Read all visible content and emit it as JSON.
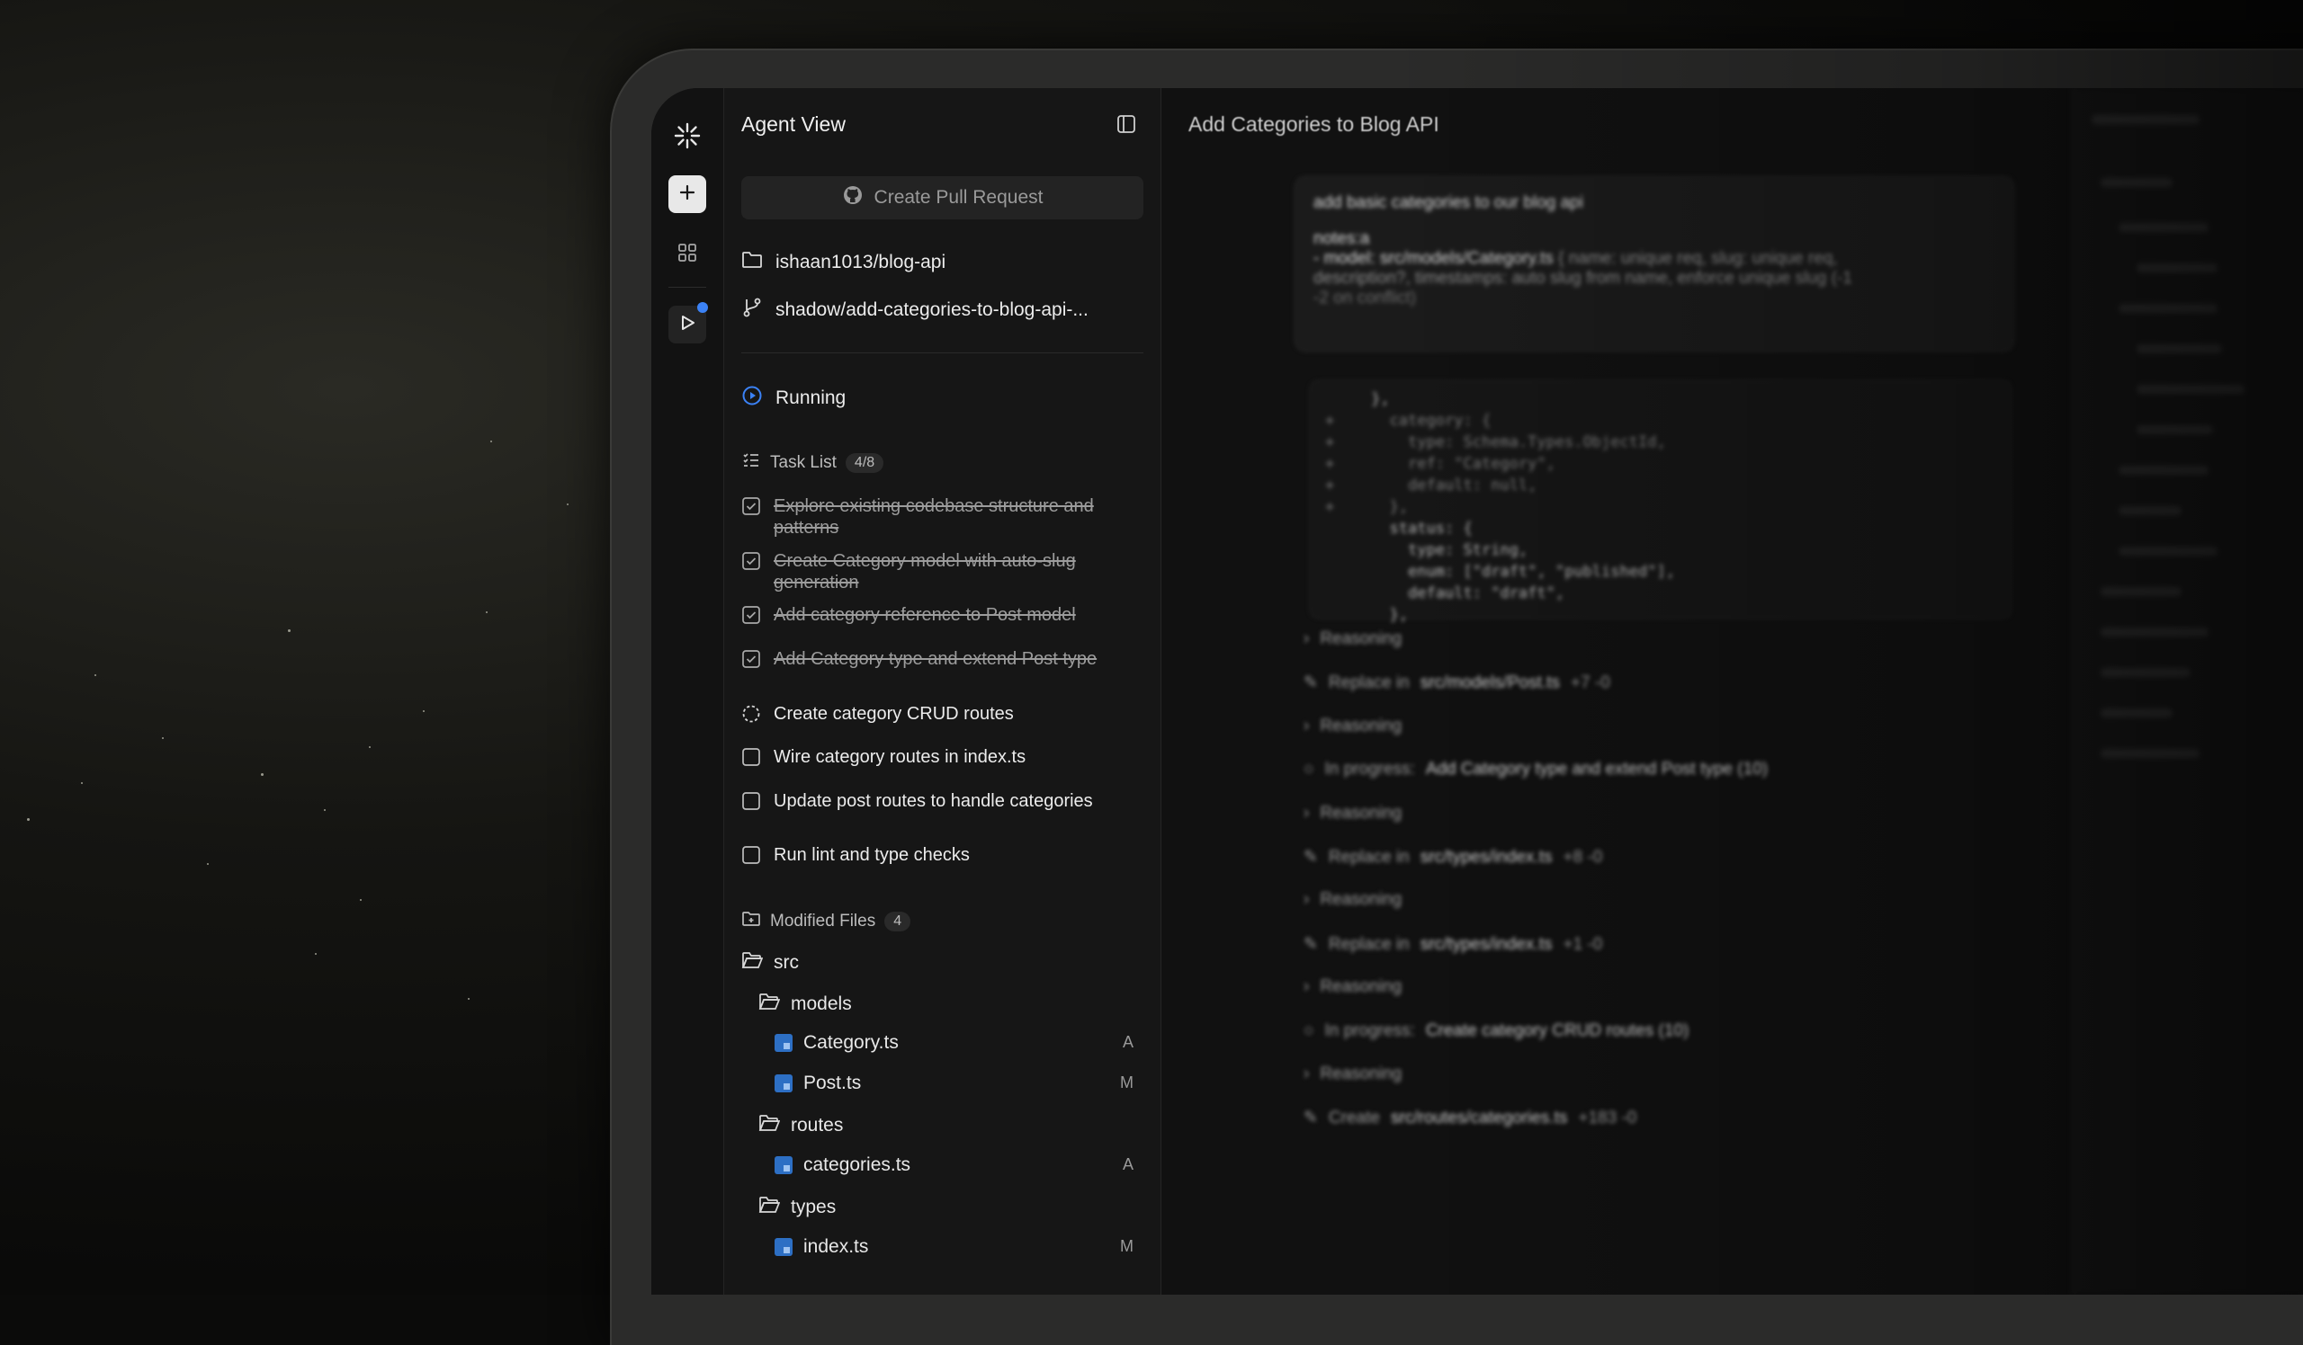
{
  "sidebar": {
    "title": "Agent View",
    "create_pr_label": "Create Pull Request",
    "repo": "ishaan1013/blog-api",
    "branch": "shadow/add-categories-to-blog-api-...",
    "status": "Running",
    "task_list": {
      "label": "Task List",
      "count": "4/8",
      "items": [
        {
          "label": "Explore existing codebase structure and patterns",
          "state": "done"
        },
        {
          "label": "Create Category model with auto-slug generation",
          "state": "done"
        },
        {
          "label": "Add category reference to Post model",
          "state": "done"
        },
        {
          "label": "Add Category type and extend Post type",
          "state": "done"
        },
        {
          "label": "Create category CRUD routes",
          "state": "in_progress"
        },
        {
          "label": "Wire category routes in index.ts",
          "state": "todo"
        },
        {
          "label": "Update post routes to handle categories",
          "state": "todo"
        },
        {
          "label": "Run lint and type checks",
          "state": "todo"
        }
      ]
    },
    "modified_files": {
      "label": "Modified Files",
      "count": "4",
      "tree": {
        "src": "src",
        "models": "models",
        "category_file": "Category.ts",
        "category_badge": "A",
        "post_file": "Post.ts",
        "post_badge": "M",
        "routes": "routes",
        "categories_file": "categories.ts",
        "categories_badge": "A",
        "types": "types",
        "index_file": "index.ts",
        "index_badge": "M"
      }
    }
  },
  "main": {
    "title": "Add Categories to Blog API",
    "user_message": {
      "line1": "add basic categories to our blog api",
      "line2": "notes:a",
      "line3_prefix": "- model: src/models/Category.ts",
      "line3_rest": "{ name: unique req, slug: unique req,",
      "line4": "description?, timestamps: auto slug from name, enforce unique slug (-1",
      "line5": "-2 on conflict)"
    },
    "code_lines": [
      "     },",
      "+      category: {",
      "+        type: Schema.Types.ObjectId,",
      "+        ref: \"Category\",",
      "+        default: null,",
      "+      },",
      "       status: {",
      "         type: String,",
      "         enum: [\"draft\", \"published\"],",
      "         default: \"draft\",",
      "       },"
    ],
    "log": {
      "reasoning": "Reasoning",
      "replace_in": "Replace in",
      "in_progress": "In progress:",
      "create": "Create",
      "r1_path": "src/models/Post.ts",
      "r1_diff": "+7 -0",
      "ip1_text": "Add Category type and extend Post type (10)",
      "r2_path": "src/types/index.ts",
      "r2_diff": "+8 -0",
      "r3_path": "src/types/index.ts",
      "r3_diff": "+1 -0",
      "ip2_text": "Create category CRUD routes (10)",
      "c1_path": "src/routes/categories.ts",
      "c1_diff": "+183 -0"
    }
  },
  "colors": {
    "accent": "#3b82f6",
    "notification_dot": "#3b82f6",
    "file_icon": "#2d6fc4"
  }
}
